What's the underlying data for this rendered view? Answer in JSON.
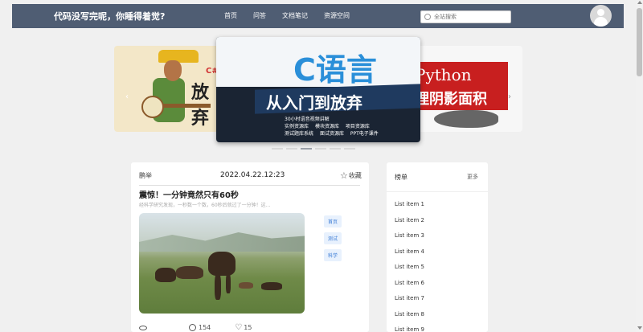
{
  "header": {
    "site_title": "代码没写完呢，你睡得着觉?",
    "nav": [
      "首页",
      "问答",
      "文档笔记",
      "资源空间"
    ],
    "search_placeholder": "全站搜索"
  },
  "carousel": {
    "left_slide": {
      "label_c": "C#",
      "label_big": "放弃"
    },
    "center_slide": {
      "title": "C语言",
      "subtitle": "从入门到放弃",
      "features": [
        "30小时语音视频讲解",
        "实例资源库",
        "模块资源库",
        "项目资源库",
        "测试题库系统",
        "面试资源库",
        "PPT电子课件"
      ]
    },
    "right_slide": {
      "line1": "Python",
      "line2": "理阴影面积"
    },
    "dot_count": 6,
    "active_dot": 2
  },
  "article": {
    "author": "鹏举",
    "date": "2022.04.22.12:23",
    "collect_label": "收藏",
    "title": "震惊！一分钟竟然只有60秒",
    "excerpt": "经科学研究发现，一秒数一个数，60秒后就过了一分钟！这...",
    "tags": [
      "首页",
      "测试",
      "科学"
    ],
    "comments": "154",
    "likes": "15"
  },
  "ranking": {
    "title": "榜单",
    "more": "更多",
    "items": [
      "List item 1",
      "List item 2",
      "List item 3",
      "List item 4",
      "List item 5",
      "List item 6",
      "List item 7",
      "List item 8",
      "List item 9"
    ]
  },
  "colors": {
    "header_bg": "#4f5d73",
    "tag_text": "#3a7bd5",
    "tag_bg": "#e8f1fd",
    "c_lang_blue": "#2a8fd9"
  }
}
